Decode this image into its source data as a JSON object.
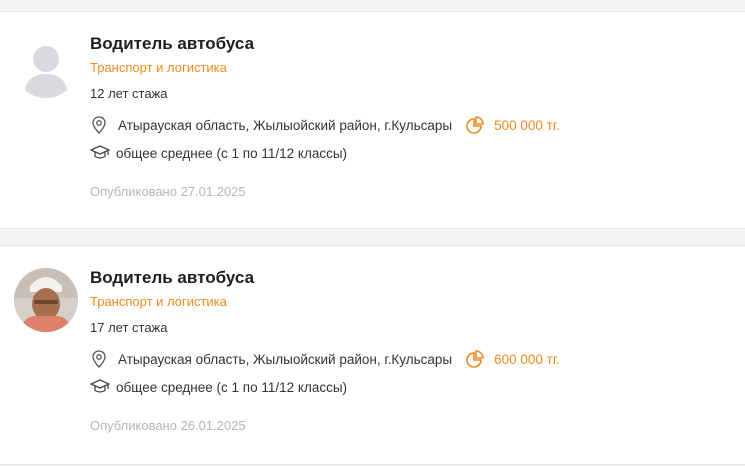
{
  "listings": [
    {
      "title": "Водитель автобуса",
      "category": "Транспорт и логистика",
      "experience": "12 лет стажа",
      "location": "Атырауская область, Жылыойский район, г.Кульсары",
      "salary": "500 000 тг.",
      "education": "общее среднее (с 1 по 11/12 классы)",
      "published": "Опубликовано 27.01.2025",
      "avatar_icon": "user-placeholder-icon"
    },
    {
      "title": "Водитель автобуса",
      "category": "Транспорт и логистика",
      "experience": "17 лет стажа",
      "location": "Атырауская область, Жылыойский район, г.Кульсары",
      "salary": "600 000 тг.",
      "education": "общее среднее (с 1 по 11/12 классы)",
      "published": "Опубликовано 26.01.2025",
      "avatar_icon": "user-photo"
    }
  ],
  "colors": {
    "accent": "#f08a1c",
    "muted": "#b5b5bb",
    "background": "#f4f4f6"
  }
}
